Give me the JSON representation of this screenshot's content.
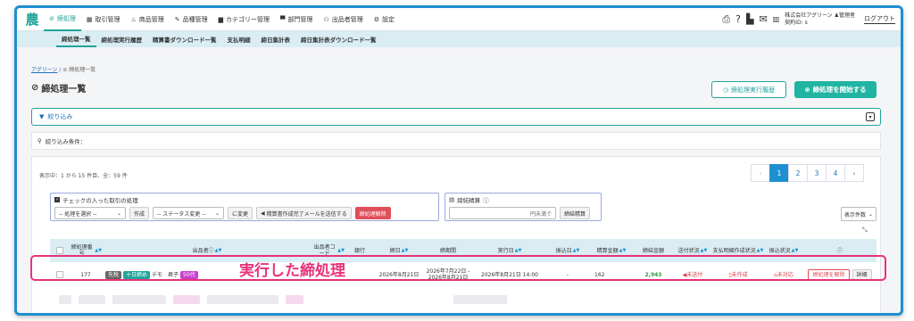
{
  "nav": {
    "items": [
      {
        "icon": "⊘",
        "label": "締処理",
        "active": true
      },
      {
        "icon": "▦",
        "label": "取引管理"
      },
      {
        "icon": "♨",
        "label": "商品管理"
      },
      {
        "icon": "✎",
        "label": "品種管理"
      },
      {
        "icon": "▆",
        "label": "カテゴリー管理"
      },
      {
        "icon": "▀",
        "label": "部門管理"
      },
      {
        "icon": "⚇",
        "label": "出品者管理"
      },
      {
        "icon": "⚙",
        "label": "設定"
      }
    ],
    "company": "株式会社アグリーン",
    "contract": "契約ID: s",
    "user": "管理者",
    "logout": "ログアウト"
  },
  "subnav": [
    "締処理一覧",
    "締処理実行履歴",
    "精算書ダウンロード一覧",
    "支払明細",
    "締日集計表",
    "締日集計表ダウンロード一覧"
  ],
  "breadcrumb": {
    "root": "アグリーン",
    "sep": "/",
    "current": "⊘ 締処理一覧"
  },
  "page_title": "締処理一覧",
  "buttons": {
    "history": "締処理実行履歴",
    "start": "締処理を開始する"
  },
  "filter": {
    "label": "絞り込み",
    "conditions_label": "絞り込み条件："
  },
  "count_text": "表示中：1 から 15 件目、全：59 件",
  "pager": {
    "prev": "‹",
    "pages": [
      "1",
      "2",
      "3",
      "4"
    ],
    "next": "›"
  },
  "bulk": {
    "label": "チェックの入った取引の処理",
    "select1": "-- 処理を選択 --",
    "btn_create": "作成",
    "select2": "-- ステータス変更 --",
    "btn_change": "に変更",
    "btn_mail": "精算書作成完了メールを送信する",
    "btn_cancel_all": "締処理解除"
  },
  "amount": {
    "label": "締結精算",
    "placeholder": "円未満で",
    "btn": "締結精算"
  },
  "per_page": "表示件数",
  "columns": [
    "締処理番号",
    "出品者",
    "出品者コード",
    "銀行",
    "締日",
    "締期間",
    "実行日",
    "振込日",
    "精算金額",
    "締結金額",
    "送付状況",
    "支払明細作成状況",
    "振込状況",
    ""
  ],
  "row": {
    "id": "177",
    "badge1": "先税",
    "badge2": "十日締め",
    "seller": "デモ　君子",
    "badge3": "50代",
    "close_date": "2026年8月21日",
    "period": "2026年7月22日 - 2026年8月21日",
    "exec_date": "2026年8月21日 14:00",
    "transfer_date": "-",
    "settle_amount": "162",
    "closing_amount": "2,943",
    "send_status": "未送付",
    "statement_status": "未作成",
    "transfer_status": "未対応",
    "btn_cancel": "締処理を解除",
    "btn_detail": "詳細"
  },
  "annotation": "実行した締処理",
  "colors": {
    "teal": "#20a39a",
    "highlight": "#e8337a",
    "blue": "#1e8fd0"
  }
}
